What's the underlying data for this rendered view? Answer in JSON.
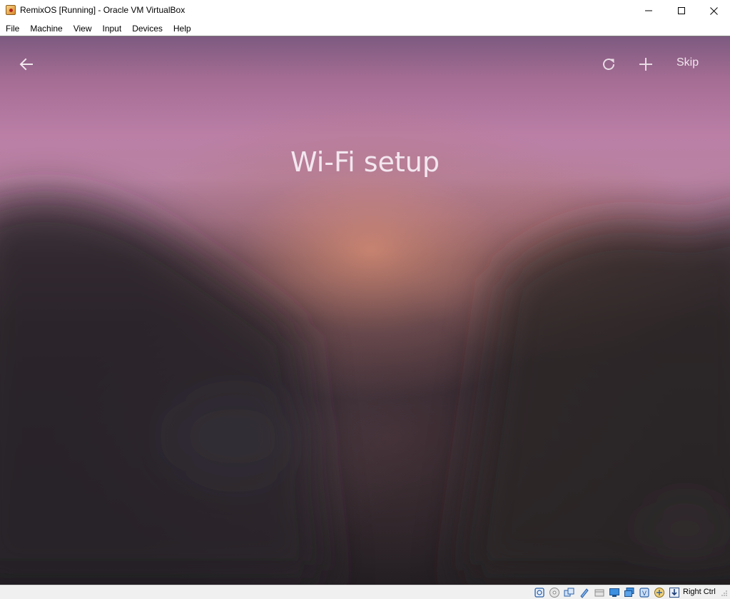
{
  "window": {
    "title": "RemixOS [Running] - Oracle VM VirtualBox",
    "app_icon": "virtualbox-icon",
    "controls": [
      "minimize-icon",
      "maximize-icon",
      "close-icon"
    ]
  },
  "menubar": {
    "items": [
      "File",
      "Machine",
      "View",
      "Input",
      "Devices",
      "Help"
    ]
  },
  "guest": {
    "toolbar": {
      "back_icon": "arrow-left-icon",
      "refresh_icon": "refresh-icon",
      "add_icon": "plus-icon",
      "skip_label": "Skip"
    },
    "page_title": "Wi-Fi setup"
  },
  "statusbar": {
    "indicator_icons": [
      "hard-disk-icon",
      "optical-drive-icon",
      "audio-icon",
      "network-icon",
      "usb-icon",
      "shared-folders-icon",
      "display-icon",
      "video-capture-icon",
      "cpu-icon",
      "mouse-integration-icon",
      "keyboard-icon"
    ],
    "host_key": "Right Ctrl"
  },
  "colors": {
    "title_text": "#f3e7ef",
    "sky_top": "#7d5a80",
    "sky_mid": "#bb7fa6",
    "ground": "#1f1d22"
  }
}
